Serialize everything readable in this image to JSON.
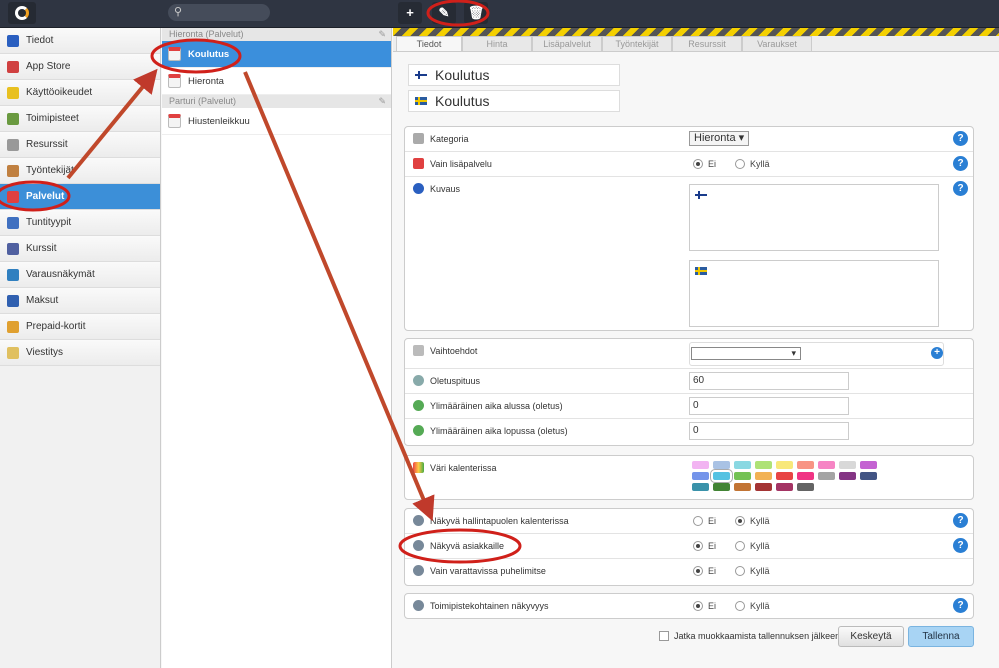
{
  "topbar": {
    "search_placeholder": "",
    "toolbar": [
      "add-icon",
      "edit-icon",
      "delete-icon"
    ]
  },
  "sidebar": {
    "items": [
      {
        "label": "Tiedot",
        "color": "#2a5fc0"
      },
      {
        "label": "App Store",
        "color": "#d04040"
      },
      {
        "label": "Käyttöoikeudet",
        "color": "#e8c020"
      },
      {
        "label": "Toimipisteet",
        "color": "#6a9a40"
      },
      {
        "label": "Resurssit",
        "color": "#999999"
      },
      {
        "label": "Työntekijät",
        "color": "#c08040"
      },
      {
        "label": "Palvelut",
        "color": "#e04040",
        "active": true
      },
      {
        "label": "Tuntityypit",
        "color": "#4070c0"
      },
      {
        "label": "Kurssit",
        "color": "#5060a0"
      },
      {
        "label": "Varausnäkymät",
        "color": "#3080c0"
      },
      {
        "label": "Maksut",
        "color": "#3060b0"
      },
      {
        "label": "Prepaid-kortit",
        "color": "#e0a030"
      },
      {
        "label": "Viestitys",
        "color": "#e0c060"
      }
    ]
  },
  "services": {
    "groups": [
      {
        "title": "Hieronta (Palvelut)",
        "items": [
          "Koulutus",
          "Hieronta"
        ]
      },
      {
        "title": "Parturi (Palvelut)",
        "items": [
          "Hiustenleikkuu"
        ]
      }
    ]
  },
  "tabs": [
    "Tiedot",
    "Hinta",
    "Lisäpalvelut",
    "Työntekijät",
    "Resurssit",
    "Varaukset"
  ],
  "form": {
    "name_fi": "Koulutus",
    "name_sv": "Koulutus",
    "kategoria": {
      "label": "Kategoria",
      "value": "Hieronta"
    },
    "vain_lisapalvelu": {
      "label": "Vain lisäpalvelu",
      "options": [
        "Ei",
        "Kyllä"
      ],
      "selected": "Ei"
    },
    "kuvaus": {
      "label": "Kuvaus"
    },
    "vaihtoehdot": {
      "label": "Vaihtoehdot",
      "value": ""
    },
    "oletuspituus": {
      "label": "Oletuspituus",
      "value": "60"
    },
    "aika_alussa": {
      "label": "Ylimääräinen aika alussa (oletus)",
      "value": "0"
    },
    "aika_lopussa": {
      "label": "Ylimääräinen aika lopussa (oletus)",
      "value": "0"
    },
    "vari": {
      "label": "Väri kalenterissa",
      "colors": [
        "#f2b4f2",
        "#a9c2e4",
        "#8ad8e2",
        "#aee276",
        "#f8e87a",
        "#f89484",
        "#f684c4",
        "#d8d8d8",
        "#c462d2",
        "#7494ea",
        "#54c2e2",
        "#74c254",
        "#f2b254",
        "#e84444",
        "#f03484",
        "#a4a4a4",
        "#843484",
        "#425484",
        "#3a92aa",
        "#428434",
        "#c27434",
        "#a43434",
        "#a43464",
        "#646464"
      ],
      "selected_index": 10
    },
    "nakyva_hallinta": {
      "label": "Näkyvä hallintapuolen kalenterissa",
      "options": [
        "Ei",
        "Kyllä"
      ],
      "selected": "Kyllä"
    },
    "nakyva_asiakkaille": {
      "label": "Näkyvä asiakkaille",
      "options": [
        "Ei",
        "Kyllä"
      ],
      "selected": "Ei"
    },
    "vain_puhelimitse": {
      "label": "Vain varattavissa puhelimitse",
      "options": [
        "Ei",
        "Kyllä"
      ],
      "selected": "Ei"
    },
    "toimipistekohtainen": {
      "label": "Toimipistekohtainen näkyvyys",
      "options": [
        "Ei",
        "Kyllä"
      ],
      "selected": "Ei"
    }
  },
  "footer": {
    "continue_label": "Jatka muokkaamista tallennuksen jälkeen",
    "cancel": "Keskeytä",
    "save": "Tallenna"
  }
}
